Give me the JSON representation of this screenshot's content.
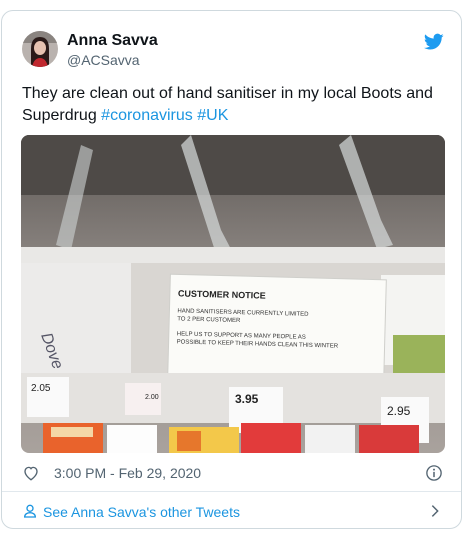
{
  "tweet": {
    "author_name": "Anna Savva",
    "author_handle": "@ACSavva",
    "text_main": "They are clean out of hand sanitiser in my local Boots and Superdrug ",
    "hashtag_1": "#coronavirus",
    "hashtag_2": "#UK",
    "timestamp": "3:00 PM - Feb 29, 2020"
  },
  "photo": {
    "notice_title": "CUSTOMER NOTICE",
    "notice_line1": "HAND SANITISERS ARE CURRENTLY LIMITED",
    "notice_line2": "TO 2 PER CUSTOMER",
    "notice_line3": "HELP US TO SUPPORT AS MANY PEOPLE AS",
    "notice_line4": "POSSIBLE TO KEEP THEIR HANDS CLEAN THIS WINTER",
    "price_1": "2.05",
    "price_2": "2.00",
    "price_3": "3.95",
    "price_4": "2.95",
    "brand_label": "Dove"
  },
  "footer": {
    "more_tweets_label": "See Anna Savva's other Tweets"
  },
  "colors": {
    "link": "#1b95e0",
    "text": "#0f1419",
    "muted": "#536471"
  },
  "icons": [
    "twitter-bird-icon",
    "heart-icon",
    "info-icon",
    "person-icon",
    "chevron-right-icon"
  ]
}
